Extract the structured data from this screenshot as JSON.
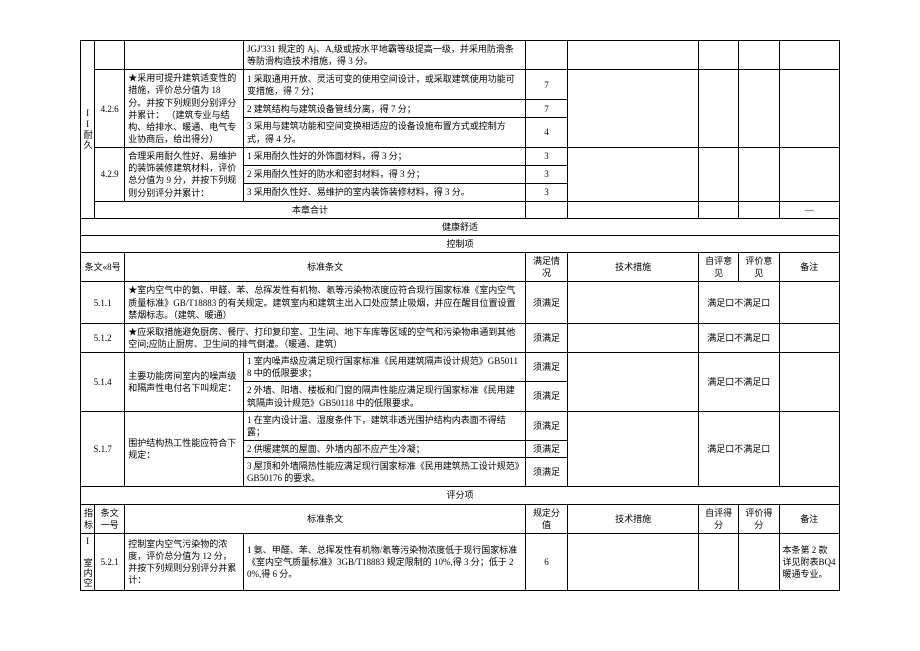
{
  "colA_label": "II耐久",
  "r1": {
    "text": "JGJ'331 规定的 Aj、A,级或按水平地霸等级提高一级，并采用防滑条等防滑构造技术措施，得 3 分。"
  },
  "r2": {
    "no": "4.2.6",
    "left": "★采用可提升建筑适变性的措施，评价总分值为 18 分。并按下列规则分别评分并累计： （建筑专业与结构、给排水、暖通、电气专业协商后，给出得分）",
    "i1": {
      "text": "1 采取通用开放、灵活可变的使用空间设计，或采取建筑使用功能可变措施，得 7 分；",
      "score": "7"
    },
    "i2": {
      "text": "2 建筑结构与建筑设备管线分离，得 7 分；",
      "score": "7"
    },
    "i3": {
      "text": "3 采用与建筑功能和空间变换相适应的设备设施布置方式或控制方式，得 4 分。",
      "score": "4"
    }
  },
  "r3": {
    "no": "4.2.9",
    "left": "合理采用耐久性好、易维护的装饰装修建筑材料，评价总分值为 9 分，并按下列规则分别评分并累计：",
    "i1": {
      "text": "1 采用耐久性好的外饰面材料，得 3 分；",
      "score": "3"
    },
    "i2": {
      "text": "2 采用耐久性好的防水和密封材料，得 3 分；",
      "score": "3"
    },
    "i3": {
      "text": "3 采用耐久性好、易维护的室内装饰装修材料，得 3 分。",
      "score": "3"
    }
  },
  "chapter_total": "本章合计",
  "dash": "—",
  "section_health": "健康舒适",
  "section_control": "控制项",
  "hdr_control": {
    "no": "条文«8号",
    "clause": "标准条文",
    "satisfy": "满足情况",
    "measure": "技术措施",
    "self": "自评意见",
    "eval": "评价意见",
    "remark": "备注"
  },
  "c511": {
    "no": "5.1.1",
    "text": "★室内空气中的氨、甲醛、苯、总挥发性有机物、氡等污染物浓度应符合现行国家标准《室内空气质量标准》GB/T18883 的有关规定。建筑室内和建筑主出入口处应禁止吸烟，并应在醒目位置设置禁烟标志。（建筑、暖通）",
    "satisfy": "须满足",
    "pass": "满足口不满足口"
  },
  "c512": {
    "no": "5.1.2",
    "text": "★应采取措施避免厨房、餐厅、打印复印室、卫生间、地下车库等区域的空气和污染物串通到其他空间;应防止厨房、卫生间的排气倒灌。（暖通、建筑）",
    "satisfy": "须满足",
    "pass": "满足口不满足口"
  },
  "c514": {
    "no": "5.1.4",
    "left": "主要功能房间室内的噪声级和隔声性电付名下叫规定：",
    "i1": {
      "text": "1 室内噪声级应满足现行国家标准《民用建筑隔声设计规范》GB50118 中的低限要求；",
      "satisfy": "须满足"
    },
    "i2": {
      "text": "2 外墙、阳墙、楼板和门窗的隔声性能应满足现行国家标准《民用建筑隔声设计规范》GB50118 中的低限要求。",
      "satisfy": "须满足"
    },
    "pass": "满足口不满足口"
  },
  "c517": {
    "no": "S.1.7",
    "left": "围护结构热工性能应符合下规定：",
    "i1": {
      "text": "1 在室内设计温、湿度条件下，建筑非透光围护结构内表面不得结露；",
      "satisfy": "须满足"
    },
    "i2": {
      "text": "2 供暖建筑的屋面、外墙内部不应产生冷凝；",
      "satisfy": "须满足"
    },
    "i3": {
      "text": "3 屋顶和外墙隔热性能应满足现行国家标准《民用建筑热工设计规范》GB50176 的要求。",
      "satisfy": "须满足"
    },
    "pass": "满足口不满足口"
  },
  "section_score": "评分项",
  "hdr_score": {
    "ind": "指标",
    "no": "条文一号",
    "clause": "标准条文",
    "maxscore": "规定分值",
    "measure": "技术措施",
    "selfscore": "自评得分",
    "evalscore": "评价得分",
    "remark": "备注"
  },
  "scoreA_label": "I 室内空",
  "s521": {
    "no": "5.2.1",
    "left": "控制室内空气污染物的浓度，评价总分值为 12 分，并按下列规则分别评分并累计：",
    "text": "1 氨、甲醛、苯、总挥发性有机物/氡等污染物浓度低于现行国家标准《室内空气质量标准》3GB/T18883 规定限制的 10%,得 3 分；低于 20%,得 6 分。",
    "score": "6",
    "remark": "本条第 2 款详见附表BQ4 暖通专业。"
  }
}
